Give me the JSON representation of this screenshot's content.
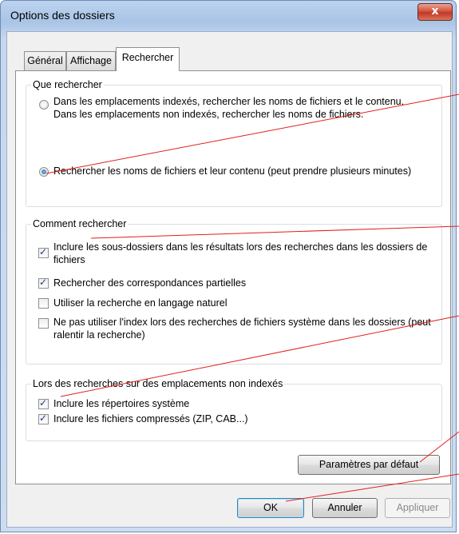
{
  "window": {
    "title": "Options des dossiers",
    "close_glyph": "x"
  },
  "tabs": [
    {
      "label": "Général",
      "active": false
    },
    {
      "label": "Affichage",
      "active": false
    },
    {
      "label": "Rechercher",
      "active": true
    }
  ],
  "what_to_search": {
    "title": "Que rechercher",
    "option1_line1": "Dans les emplacements indexés, rechercher les noms de fichiers et le contenu.",
    "option1_line2": "Dans les emplacements non indexés, rechercher les noms de fichiers.",
    "option1_selected": false,
    "option2": "Rechercher les noms de fichiers et leur contenu (peut prendre plusieurs minutes)",
    "option2_selected": true
  },
  "how_to_search": {
    "title": "Comment rechercher",
    "items": [
      {
        "line1": "Inclure les sous-dossiers dans les résultats lors des recherches dans les dossiers de",
        "line2": "fichiers",
        "checked": true
      },
      {
        "line1": "Rechercher des correspondances partielles",
        "line2": "",
        "checked": true
      },
      {
        "line1": "Utiliser la recherche en langage naturel",
        "line2": "",
        "checked": false
      },
      {
        "line1": "Ne pas utiliser l'index lors des recherches de fichiers système dans les dossiers (peut",
        "line2": "ralentir la recherche)",
        "checked": false
      }
    ]
  },
  "non_indexed": {
    "title": "Lors des recherches sur des emplacements non indexés",
    "items": [
      {
        "label": "Inclure les répertoires système",
        "checked": true
      },
      {
        "label": "Inclure les fichiers compressés (ZIP, CAB...)",
        "checked": true
      }
    ]
  },
  "buttons": {
    "defaults": "Paramètres par défaut",
    "ok": "OK",
    "cancel": "Annuler",
    "apply": "Appliquer"
  },
  "colors": {
    "annotation_line": "#e0201e",
    "selection_blue": "#1c5a98"
  },
  "icons": [
    "close-icon",
    "radio-icon",
    "checkbox-icon"
  ]
}
